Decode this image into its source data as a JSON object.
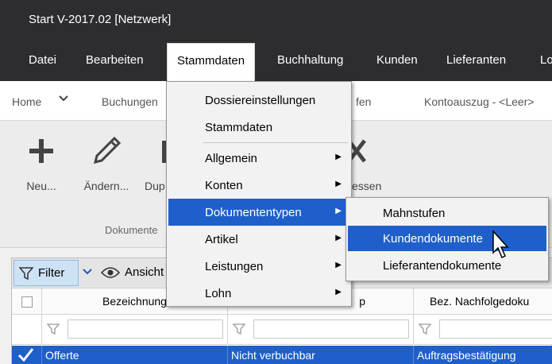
{
  "window": {
    "title": "Start V-2017.02 [Netzwerk]"
  },
  "menubar": {
    "items": [
      "Datei",
      "Bearbeiten",
      "Stammdaten",
      "Buchhaltung",
      "Kunden",
      "Lieferanten",
      "Lo"
    ]
  },
  "breadcrumb": {
    "home": "Home",
    "item1": "Buchungen",
    "item2": "fen",
    "item3": "Kontoauszug - <Leer>"
  },
  "ribbon": {
    "new_label": "Neu...",
    "edit_label": "Ändern...",
    "dup_label": "Dup",
    "close_label": "essen",
    "group_label": "Dokumente"
  },
  "grid": {
    "filter_label": "Filter",
    "view_label": "Ansicht",
    "columns": [
      "Bezeichnung",
      "p",
      "Bez. Nachfolgedoku"
    ],
    "row": [
      "Offerte",
      "Nicht verbuchbar",
      "Auftragsbestätigung"
    ]
  },
  "dropdown": {
    "items": [
      "Dossiereinstellungen",
      "Stammdaten",
      "Allgemein",
      "Konten",
      "Dokumententypen",
      "Artikel",
      "Leistungen",
      "Lohn"
    ]
  },
  "submenu": {
    "items": [
      "Mahnstufen",
      "Kundendokumente",
      "Lieferantendokumente"
    ]
  }
}
